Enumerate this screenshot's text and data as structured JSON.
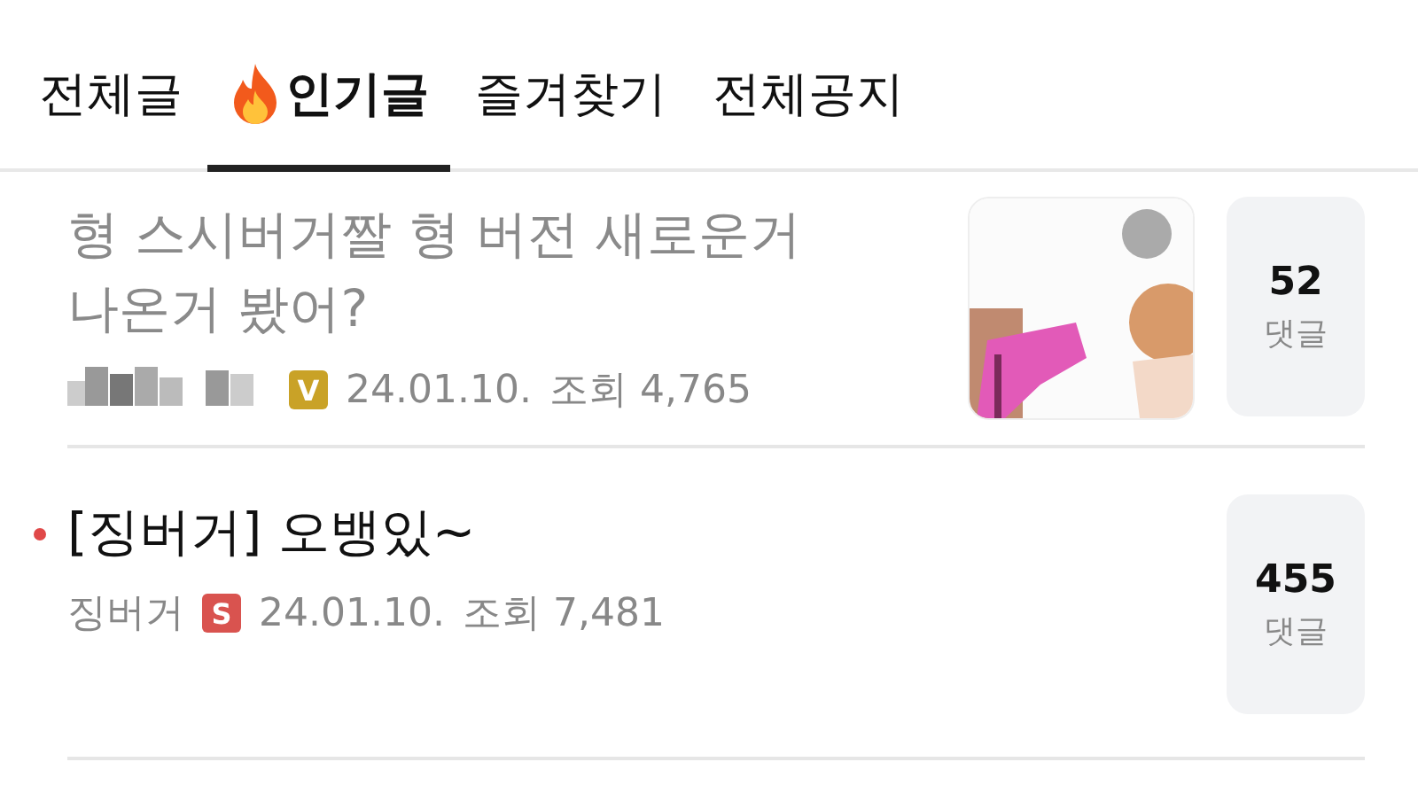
{
  "tabs": [
    {
      "label": "전체글",
      "selected": false,
      "hot": false
    },
    {
      "label": "인기글",
      "selected": true,
      "hot": true
    },
    {
      "label": "즐겨찾기",
      "selected": false,
      "hot": false
    },
    {
      "label": "전체공지",
      "selected": false,
      "hot": false
    }
  ],
  "posts": [
    {
      "title": "형 스시버거짤 형 버전 새로운거 나온거 봤어?",
      "read": true,
      "author_blurred": true,
      "badge": {
        "letter": "V",
        "color": "#c9a227"
      },
      "date": "24.01.10.",
      "views": "조회 4,765",
      "comments": "52",
      "comments_label": "댓글"
    },
    {
      "title": "[징버거] 오뱅있~",
      "read": false,
      "author_blurred": false,
      "author": "징버거",
      "badge": {
        "letter": "S",
        "color": "#d9534f"
      },
      "date": "24.01.10.",
      "views": "조회 7,481",
      "comments": "455",
      "comments_label": "댓글"
    }
  ]
}
